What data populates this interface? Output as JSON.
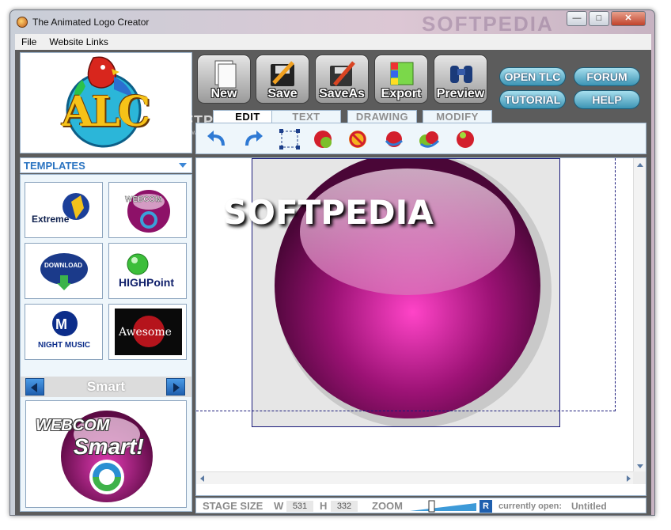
{
  "window": {
    "title": "The Animated Logo Creator",
    "watermark": "SOFTPEDIA"
  },
  "window_controls": {
    "minimize": "—",
    "maximize": "□",
    "close": "✕"
  },
  "menu": {
    "items": [
      "File",
      "Website Links"
    ]
  },
  "logo": {
    "text": "ALC",
    "watermark": "SOFTPEDIA",
    "watermark_url": "www.softpedia.com"
  },
  "toolbar": {
    "buttons": [
      {
        "label": "New",
        "icon": "new-document-icon"
      },
      {
        "label": "Save",
        "icon": "save-disk-icon"
      },
      {
        "label": "SaveAs",
        "icon": "save-as-icon"
      },
      {
        "label": "Export",
        "icon": "export-palette-icon"
      },
      {
        "label": "Preview",
        "icon": "binoculars-icon"
      }
    ],
    "links": [
      "OPEN TLC",
      "FORUM",
      "TUTORIAL",
      "HELP"
    ]
  },
  "tabs": {
    "items": [
      "EDIT",
      "TEXT",
      "DRAWING",
      "MODIFY"
    ],
    "active": "EDIT"
  },
  "edit_tools": [
    "undo-icon",
    "redo-icon",
    "select-box-icon",
    "delete-ball-icon",
    "no-ball-icon",
    "rotate-ball-icon",
    "multi-ball-icon",
    "single-ball-icon"
  ],
  "templates": {
    "header": "TEMPLATES",
    "thumbnails": [
      "Extreme",
      "WEBCOM Smart!",
      "DOWNLOAD SHOPPER",
      "HIGHPoint",
      "NIGHT MUSIC",
      "Awesome"
    ],
    "selected_label": "Smart",
    "preview_text": [
      "WEBCOM",
      "Smart!"
    ]
  },
  "canvas": {
    "watermark": "SOFTPEDIA",
    "accent": "#8a1060"
  },
  "status": {
    "stage_size_label": "STAGE SIZE",
    "w_label": "W",
    "w_value": "531",
    "h_label": "H",
    "h_value": "332",
    "zoom_label": "ZOOM",
    "zoom_reset": "R",
    "currently_open_label": "currently open:",
    "currently_open_value": "Untitled"
  }
}
